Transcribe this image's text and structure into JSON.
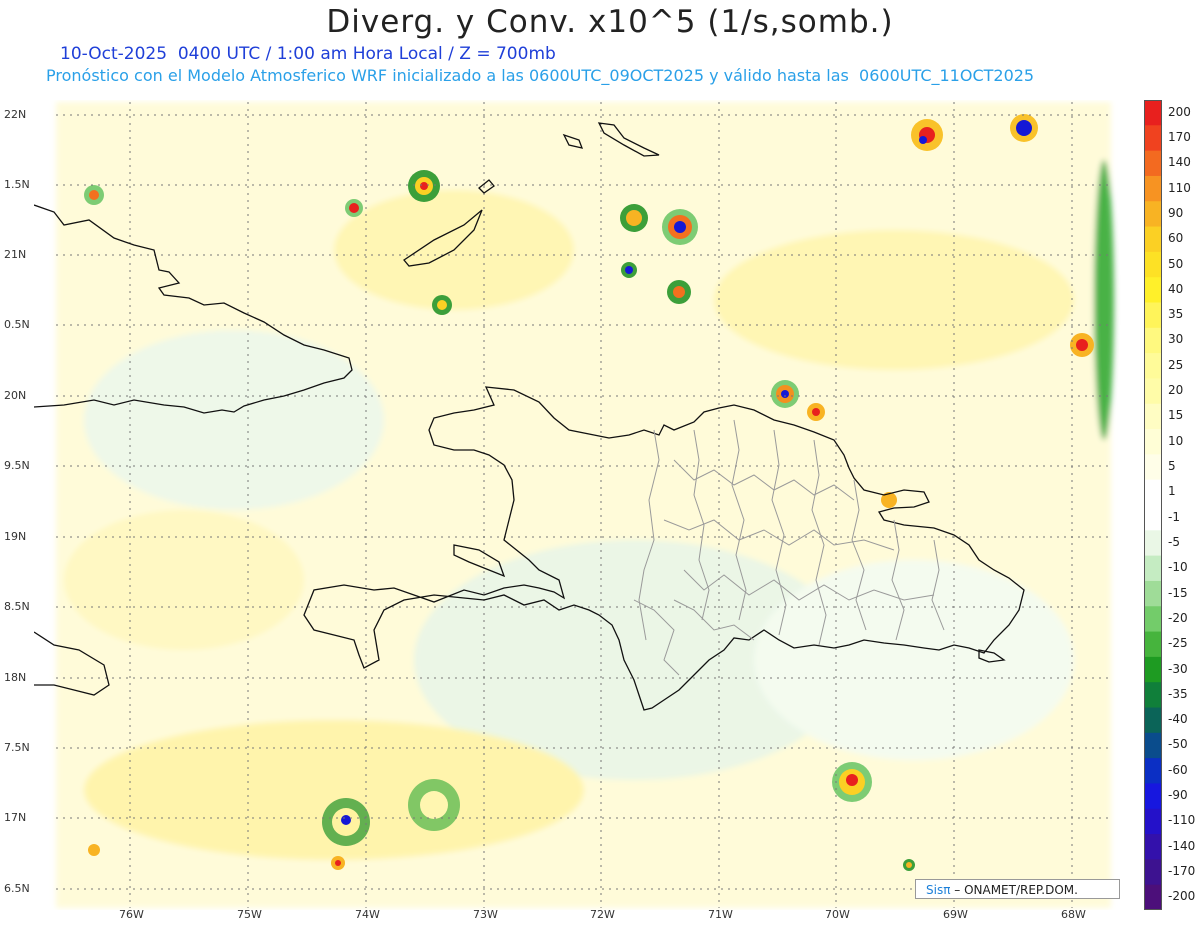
{
  "header": {
    "title": "Diverg. y Conv. x10^5 (1/s,somb.)",
    "subtitle1": "10-Oct-2025  0400 UTC / 1:00 am Hora Local / Z = 700mb",
    "subtitle2": "Pronóstico con el Modelo Atmosferico WRF inicializado a las 0600UTC_09OCT2025 y válido hasta las  0600UTC_11OCT2025"
  },
  "axes": {
    "y_ticks": [
      "22N",
      "1.5N",
      "21N",
      "0.5N",
      "20N",
      "9.5N",
      "19N",
      "8.5N",
      "18N",
      "7.5N",
      "17N",
      "6.5N"
    ],
    "x_ticks": [
      "76W",
      "75W",
      "74W",
      "73W",
      "72W",
      "71W",
      "70W",
      "69W",
      "68W"
    ]
  },
  "colorbar": {
    "labels": [
      "200",
      "170",
      "140",
      "110",
      "90",
      "60",
      "50",
      "40",
      "35",
      "30",
      "25",
      "20",
      "15",
      "10",
      "5",
      "1",
      "-1",
      "-5",
      "-10",
      "-15",
      "-20",
      "-25",
      "-30",
      "-35",
      "-40",
      "-50",
      "-60",
      "-90",
      "-110",
      "-140",
      "-170",
      "-200"
    ],
    "colors": [
      "#e8201e",
      "#f0421f",
      "#f36a20",
      "#f79322",
      "#f8b323",
      "#fbd024",
      "#fde125",
      "#fff02a",
      "#fff45a",
      "#fff97f",
      "#fffb99",
      "#fffca8",
      "#fffdc3",
      "#fffed6",
      "#fffee8",
      "#ffffff",
      "#ffffff",
      "#eaf7e6",
      "#c5ecc2",
      "#9fdc98",
      "#73cc6a",
      "#46b43d",
      "#1e9b22",
      "#107f3a",
      "#0b6458",
      "#0a4c8c",
      "#0b2fc4",
      "#1717df",
      "#2411c9",
      "#3311ab",
      "#3d1290",
      "#4c0f7a"
    ]
  },
  "credit": {
    "logo": "Sisπ",
    "text": " – ONAMET/REP.DOM."
  },
  "map_colors": {
    "background": "#fffdc9",
    "land_line": "#111111",
    "province_line": "#9a9a9a",
    "grid": "#777777"
  }
}
